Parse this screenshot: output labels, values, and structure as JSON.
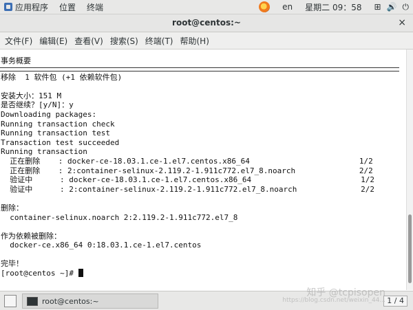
{
  "topbar": {
    "apps_label": "应用程序",
    "places_label": "位置",
    "terminal_label": "终端",
    "lang": "en",
    "clock": "星期二 09：58"
  },
  "window": {
    "title": "root@centos:~",
    "close_glyph": "×"
  },
  "menubar": {
    "items": [
      "文件(F)",
      "编辑(E)",
      "查看(V)",
      "搜索(S)",
      "终端(T)",
      "帮助(H)"
    ]
  },
  "terminal": {
    "lines_top": [
      "事务概要"
    ],
    "lines": [
      "移除  1 软件包 (+1 依赖软件包)",
      "",
      "安装大小：151 M",
      "是否继续？[y/N]：y",
      "Downloading packages:",
      "Running transaction check",
      "Running transaction test",
      "Transaction test succeeded",
      "Running transaction",
      "  正在删除    : docker-ce-18.03.1.ce-1.el7.centos.x86_64                        1/2",
      "  正在删除    : 2:container-selinux-2.119.2-1.911c772.el7_8.noarch              2/2",
      "  验证中      : docker-ce-18.03.1.ce-1.el7.centos.x86_64                        1/2",
      "  验证中      : 2:container-selinux-2.119.2-1.911c772.el7_8.noarch              2/2",
      "",
      "删除：",
      "  container-selinux.noarch 2:2.119.2-1.911c772.el7_8",
      "",
      "作为依赖被删除：",
      "  docker-ce.x86_64 0:18.03.1.ce-1.el7.centos",
      "",
      "完毕！"
    ],
    "prompt": "[root@centos ~]# "
  },
  "taskbar": {
    "task_label": "root@centos:~",
    "pager": "1 / 4"
  },
  "watermark": {
    "main": "知乎 @tcpisopen",
    "sub": "https://blog.csdn.net/weixin_44..."
  }
}
